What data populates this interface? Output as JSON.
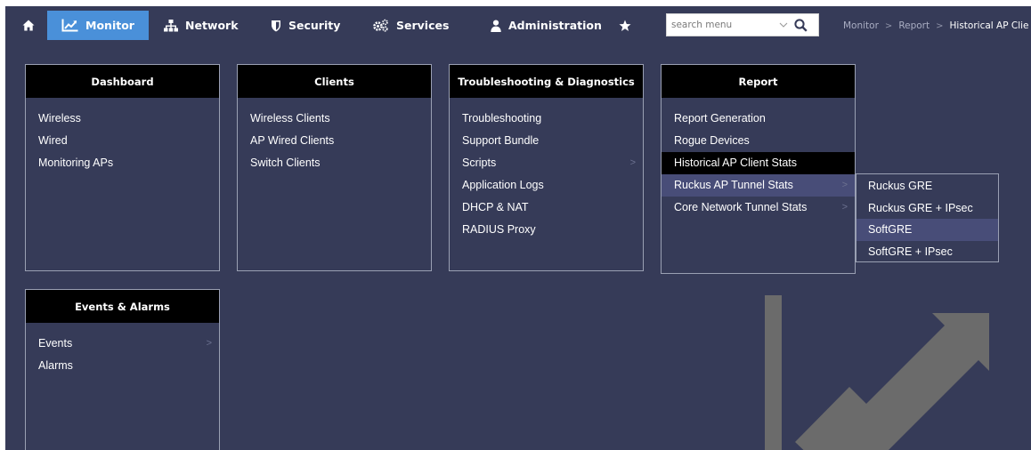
{
  "colors": {
    "background": "#363b58",
    "nav_active": "#4a90d9",
    "panel_header": "#000000",
    "hover": "#484d78",
    "watermark": "#6b6b6b"
  },
  "nav": {
    "home_icon": "home-icon",
    "items": [
      {
        "label": "Monitor",
        "icon": "line-chart-icon"
      },
      {
        "label": "Network",
        "icon": "sitemap-icon"
      },
      {
        "label": "Security",
        "icon": "shield-icon"
      },
      {
        "label": "Services",
        "icon": "gears-icon"
      },
      {
        "label": "Administration",
        "icon": "user-icon"
      }
    ],
    "favorite_icon": "star-icon"
  },
  "search": {
    "placeholder": "search menu",
    "value": ""
  },
  "breadcrumb": [
    "Monitor",
    "Report",
    "Historical AP Clie"
  ],
  "menu": {
    "panels": [
      {
        "title": "Dashboard",
        "items": [
          "Wireless",
          "Wired",
          "Monitoring APs"
        ]
      },
      {
        "title": "Clients",
        "items": [
          "Wireless Clients",
          "AP Wired Clients",
          "Switch Clients"
        ]
      },
      {
        "title": "Troubleshooting & Diagnostics",
        "items": [
          "Troubleshooting",
          "Support Bundle",
          "Scripts",
          "Application Logs",
          "DHCP & NAT",
          "RADIUS Proxy"
        ]
      },
      {
        "title": "Report",
        "items": [
          "Report Generation",
          "Rogue Devices",
          "Historical AP Client Stats",
          "Ruckus AP Tunnel Stats",
          "Core Network Tunnel Stats"
        ]
      },
      {
        "title": "Events & Alarms",
        "items": [
          "Events",
          "Alarms"
        ]
      }
    ],
    "flyout": {
      "items": [
        "Ruckus GRE",
        "Ruckus GRE + IPsec",
        "SoftGRE",
        "SoftGRE + IPsec"
      ]
    }
  }
}
